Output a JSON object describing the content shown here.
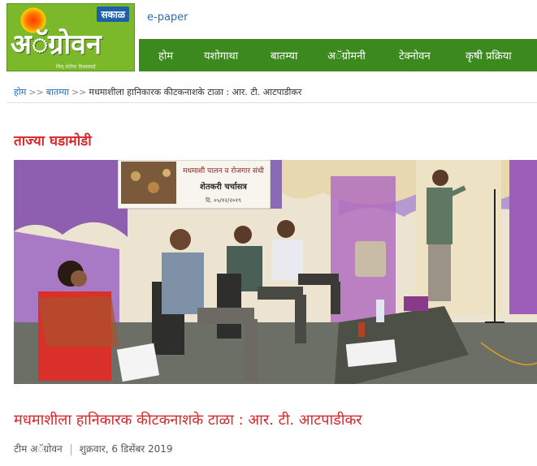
{
  "logo": {
    "badge": "सकाळ",
    "name": "अॅग्रोवन",
    "tagline": "मिल् शेतीचा विश्वासार्ह"
  },
  "header": {
    "epaper_label": "e-paper"
  },
  "nav": {
    "items": [
      {
        "label": "होम"
      },
      {
        "label": "यशोगाथा"
      },
      {
        "label": "बातम्या"
      },
      {
        "label": "अॅग्रोमनी"
      },
      {
        "label": "टेक्नोवन"
      },
      {
        "label": "कृषी प्रक्रिया"
      }
    ]
  },
  "breadcrumb": {
    "home": "होम",
    "sep": ">>",
    "news": "बातम्या",
    "current": "मधमाशीला हानिकारक कीटकनाशके टाळा : आर. टी. आटपाडीकर"
  },
  "section": {
    "title": "ताज्या घडामोडी"
  },
  "photo": {
    "banner_line1": "मधमाशी पालन व रोजगार संधी",
    "banner_line2": "शेतकरी चर्चासत्र",
    "banner_date": "दि. ०५/१२/२०१९"
  },
  "article": {
    "title": "मधमाशीला हानिकारक कीटकनाशके टाळा : आर. टी. आटपाडीकर",
    "author": "टीम अॅग्रोवन",
    "date": "शुक्रवार, 6 डिसेंबर 2019"
  },
  "colors": {
    "brand_green": "#3c8a1e",
    "logo_green": "#7bb82a",
    "accent_red": "#d6272b",
    "link_blue": "#2a6db5"
  }
}
